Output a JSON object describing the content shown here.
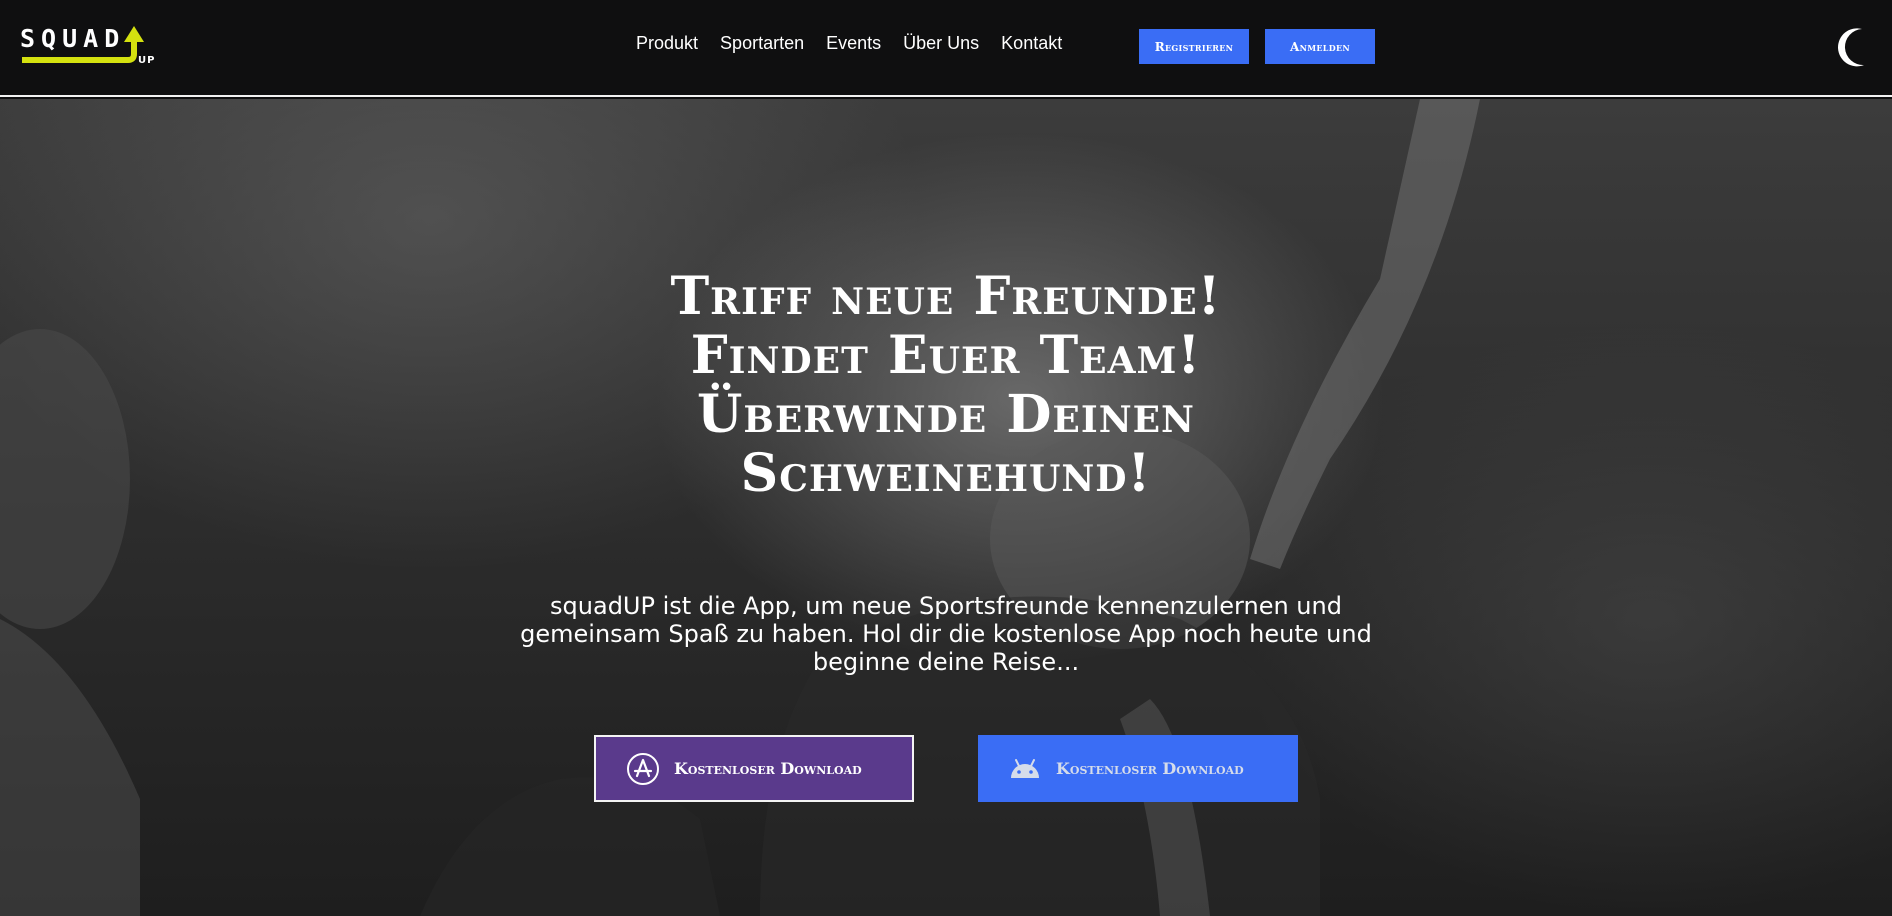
{
  "brand": {
    "logo_word": "SQUAD",
    "logo_sub": "UP",
    "accent": "#d4e10f"
  },
  "nav": {
    "items": [
      {
        "label": "Produkt"
      },
      {
        "label": "Sportarten"
      },
      {
        "label": "Events"
      },
      {
        "label": "Über Uns"
      },
      {
        "label": "Kontakt"
      }
    ],
    "register_label": "Registrieren",
    "login_label": "Anmelden",
    "theme_toggle_icon": "moon-icon"
  },
  "hero": {
    "headline": [
      "Triff neue Freunde!",
      "Findet Euer Team!",
      "Überwinde Deinen",
      "Schweinehund!"
    ],
    "lead": "squadUP ist die App, um neue Sportsfreunde kennenzulernen und gemeinsam Spaß zu haben. Hol dir die kostenlose App noch heute und beginne deine Reise...",
    "download_ios": {
      "label": "Kostenloser Download",
      "icon": "app-store-icon",
      "color": "#5a3a8c"
    },
    "download_android": {
      "label": "Kostenloser Download",
      "icon": "android-icon",
      "color": "#3a6df5"
    }
  },
  "colors": {
    "header_bg": "#0f0f10",
    "primary_button": "#3a6df5"
  }
}
